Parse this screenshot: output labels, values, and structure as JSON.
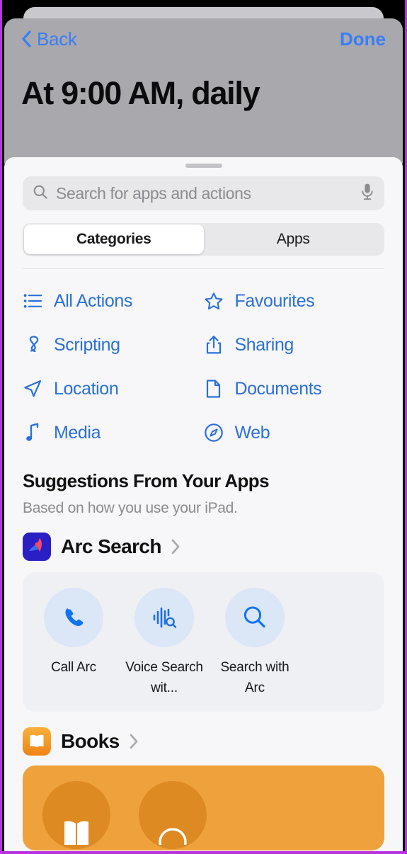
{
  "editor": {
    "back_label": "Back",
    "done_label": "Done",
    "title": "At 9:00 AM, daily",
    "back_icon": "chevron-left-icon"
  },
  "search": {
    "placeholder": "Search for apps and actions",
    "value": "",
    "search_icon": "search-icon",
    "mic_icon": "microphone-icon"
  },
  "segmented": {
    "tabs": [
      {
        "label": "Categories",
        "selected": true
      },
      {
        "label": "Apps",
        "selected": false
      }
    ]
  },
  "categories": [
    {
      "label": "All Actions",
      "icon": "list-bullet-icon"
    },
    {
      "label": "Favourites",
      "icon": "star-icon"
    },
    {
      "label": "Scripting",
      "icon": "scripting-icon"
    },
    {
      "label": "Sharing",
      "icon": "share-icon"
    },
    {
      "label": "Location",
      "icon": "location-arrow-icon"
    },
    {
      "label": "Documents",
      "icon": "document-icon"
    },
    {
      "label": "Media",
      "icon": "music-note-icon"
    },
    {
      "label": "Web",
      "icon": "compass-icon"
    }
  ],
  "suggestions": {
    "title": "Suggestions From Your Apps",
    "subtitle": "Based on how you use your iPad.",
    "apps": [
      {
        "name": "Arc Search",
        "icon": "arc-search-app-icon",
        "disclosure_icon": "chevron-right-icon",
        "tiles": [
          {
            "label": "Call Arc",
            "icon": "phone-icon"
          },
          {
            "label": "Voice Search wit...",
            "icon": "voice-search-icon"
          },
          {
            "label": "Search with Arc",
            "icon": "magnifier-icon"
          }
        ]
      },
      {
        "name": "Books",
        "icon": "books-app-icon",
        "disclosure_icon": "chevron-right-icon",
        "tiles": [
          {
            "label": "",
            "icon": "open-book-icon"
          },
          {
            "label": "",
            "icon": "circle-icon"
          }
        ]
      }
    ]
  },
  "colors": {
    "accent_blue": "#3b7ef5",
    "category_blue": "#2b70d8",
    "sheet_bg": "#f7f7f9",
    "editor_bg": "#a8a8ad",
    "tile_bg": "#eff0f4",
    "tile_circle": "#dbe6f7",
    "books_orange": "#efa13c",
    "frame_border": "#b734e0"
  }
}
